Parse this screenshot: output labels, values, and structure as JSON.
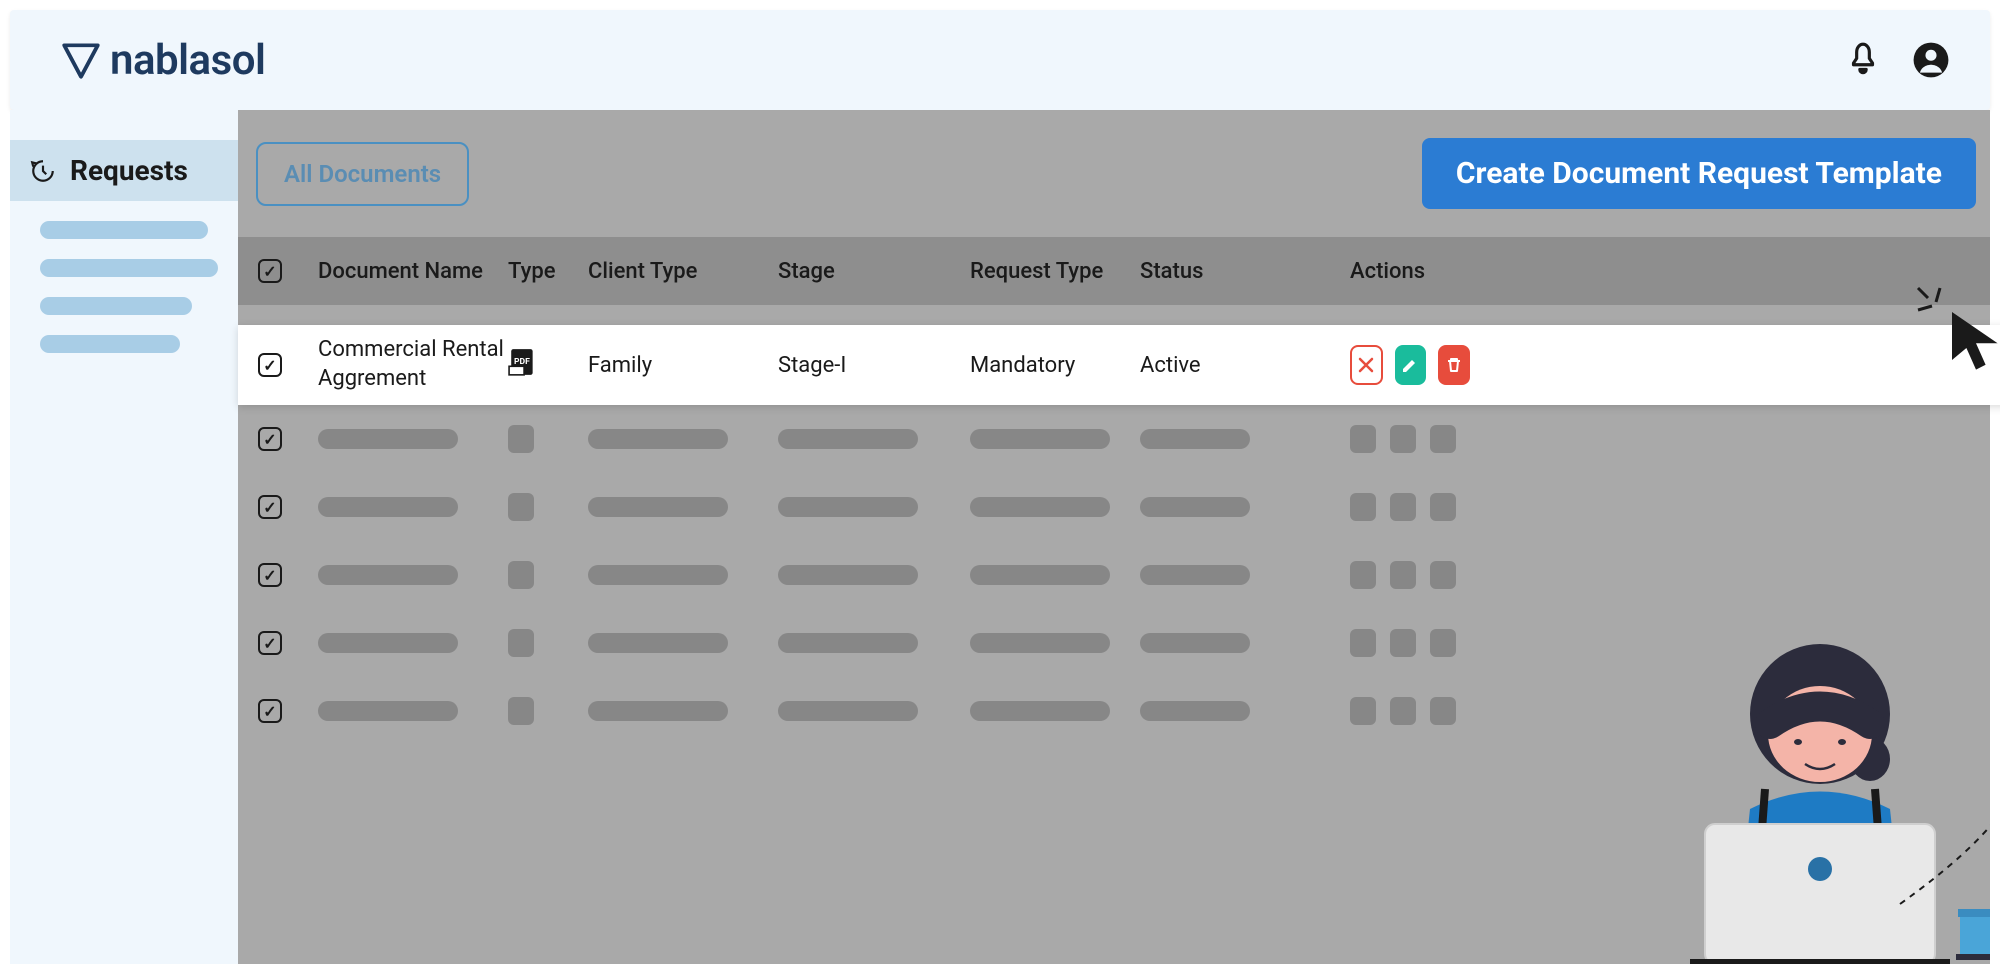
{
  "header": {
    "logo_text": "nablasol"
  },
  "sidebar": {
    "nav_label": "Requests"
  },
  "toolbar": {
    "filter_label": "All Documents",
    "create_label": "Create Document Request Template"
  },
  "table": {
    "columns": {
      "name": "Document Name",
      "type": "Type",
      "client_type": "Client Type",
      "stage": "Stage",
      "request_type": "Request Type",
      "status": "Status",
      "actions": "Actions"
    },
    "rows": [
      {
        "name": "Commercial Rental Aggrement",
        "type_icon": "pdf",
        "client_type": "Family",
        "stage": "Stage-I",
        "request_type": "Mandatory",
        "status": "Active"
      }
    ]
  }
}
